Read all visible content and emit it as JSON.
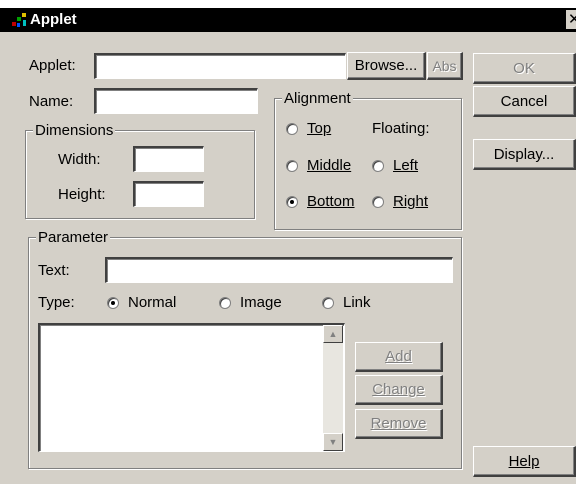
{
  "window": {
    "title": "Applet",
    "close_glyph": "✕"
  },
  "applet_row": {
    "label": "Applet:",
    "value": "",
    "browse": "Browse...",
    "abs": "Abs"
  },
  "name_row": {
    "label": "Name:",
    "value": ""
  },
  "dimensions": {
    "title": "Dimensions",
    "width_label": "Width:",
    "height_label": "Height:",
    "width_value": "",
    "height_value": ""
  },
  "alignment": {
    "title": "Alignment",
    "floating_label": "Floating:",
    "top": "Top",
    "middle": "Middle",
    "bottom": "Bottom",
    "left": "Left",
    "right": "Right",
    "selected": "Bottom"
  },
  "parameter": {
    "title": "Parameter",
    "text_label": "Text:",
    "text_value": "",
    "type_label": "Type:",
    "normal": "Normal",
    "image": "Image",
    "link": "Link",
    "selected_type": "Normal",
    "add": "Add",
    "change": "Change",
    "remove": "Remove"
  },
  "buttons": {
    "ok": "OK",
    "cancel": "Cancel",
    "display": "Display...",
    "help": "Help"
  },
  "icons": {
    "scroll_up": "up-arrow-icon",
    "scroll_down": "down-arrow-icon"
  }
}
